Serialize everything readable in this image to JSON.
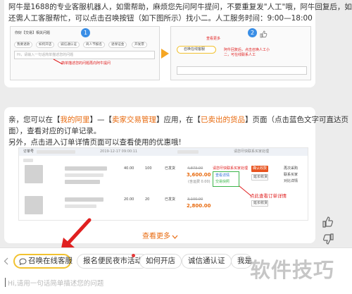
{
  "intro": {
    "line1": "阿牛是1688的专业客服机器人，如需帮助，麻烦您先问阿牛提问，不要重复发\"人工\"哦，阿牛回复后，如",
    "line2": "还需人工客服帮忙，可以点击召唤按钮（如下图所示）找小二。人工服务时间：9:00—18:00"
  },
  "guide_left": {
    "badge": "1",
    "header": "你好【交易】相关问题",
    "chips": [
      "我要退款",
      "如何开店",
      "诚信通认证",
      "商人节报名",
      "退保证金",
      "开发票"
    ],
    "input_placeholder": "Hi，请输入一句话简单描述您的问题",
    "hint": "简单描述您的问题再向阿牛提问"
  },
  "guide_right": {
    "badge": "2",
    "tag": "查看更多",
    "summon_label": "召唤在线客服",
    "hint": "阿牛回复后，点击召唤人工小二，可在线联系人工"
  },
  "msg": {
    "p1_a": "亲，您可以在【",
    "p1_link1": "我的阿里",
    "p1_b": "】—【",
    "p1_link2": "卖家交易管理",
    "p1_c": "】应用，在【",
    "p1_link3": "已卖出的货品",
    "p1_d": "】页面（点击蓝色文字可直达页",
    "p2": "面），查看对应的订单记录。",
    "p3": "另外，点击进入订单详情页面可以查看使用的优惠哦!"
  },
  "order_shot": {
    "header_order": "订单号",
    "header_date": "2019-12-17 09:00:11",
    "header_right": "请您尽快联系买家处理",
    "row1": {
      "price": "40.00",
      "qty": "100",
      "status": "已发货",
      "price_old": "4,873.00",
      "total": "3,600.00",
      "freight": "(含运费 0.00)",
      "action_red": "确认收款",
      "action2": "延长收货",
      "right1": "再次采购",
      "right2": "联系买家",
      "right3": "对比详情",
      "detail_label": "查看详情",
      "detail_sub": "交易快照"
    },
    "row2": {
      "price": "20.00",
      "qty": "20",
      "status": "已发货",
      "price_old": "3,100.00",
      "total": "2,800.00",
      "action_red": "确认收款",
      "action2": "延长收货"
    },
    "note": "点此查看订单详情",
    "more_link": "查看更多"
  },
  "quick_actions": [
    "召唤在线客服",
    "报名便民夜市活动",
    "如何开店",
    "诚信通认证",
    "我是"
  ],
  "input": {
    "placeholder": "Hi,请用一句话简单描述您的问题"
  },
  "watermark": "软件技巧",
  "colors": {
    "link": "#e86b10",
    "arrow": "#e02020",
    "summon_border": "#f2c230",
    "accent_blue": "#3a8ee6"
  }
}
